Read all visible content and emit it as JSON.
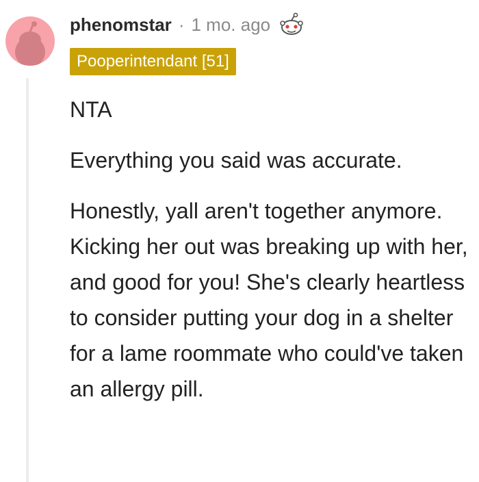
{
  "comment": {
    "username": "phenomstar",
    "separator": "·",
    "timestamp": "1 mo. ago",
    "award_icon": "snoo-award-icon",
    "flair": "Pooperintendant [51]",
    "paragraphs": [
      "NTA",
      "Everything you said was accurate.",
      "Honestly, yall aren't together anymore. Kicking her out was breaking up with her, and good for you! She's clearly heartless to consider putting your dog in a shelter for a lame roommate who could've taken an allergy pill."
    ]
  },
  "colors": {
    "avatar_bg": "#f7a3a9",
    "flair_bg": "#c9a208",
    "meta_gray": "#8a8a8a",
    "thread_line": "#ececec"
  }
}
